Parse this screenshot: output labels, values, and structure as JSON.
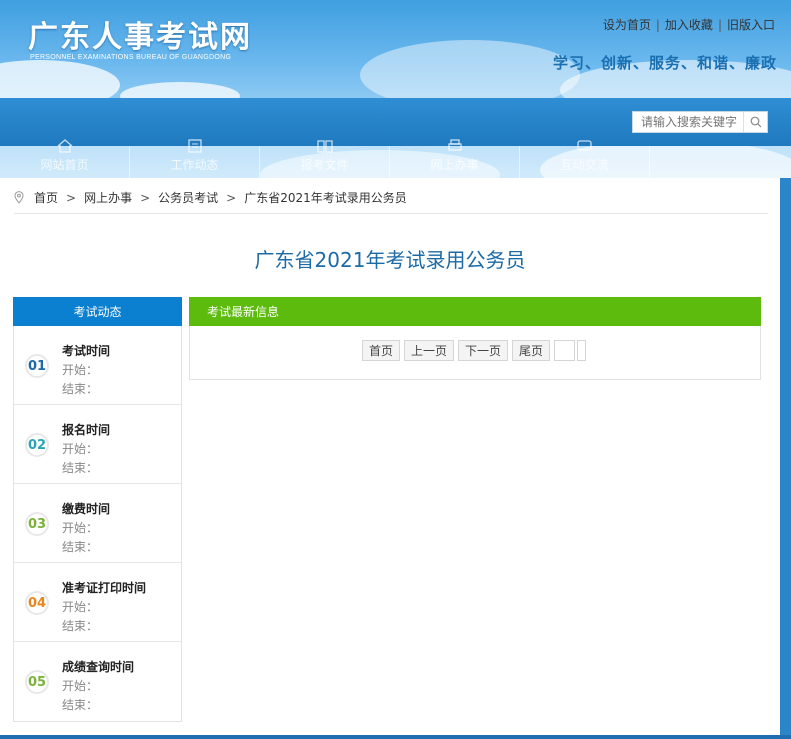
{
  "header": {
    "logo_title": "广东人事考试网",
    "logo_subtitle": "PERSONNEL EXAMINATIONS BUREAU OF GUANGDONG",
    "top_links": [
      "设为首页",
      "加入收藏",
      "旧版入口"
    ],
    "slogan": "学习、创新、服务、和谐、廉政",
    "search_placeholder": "请输入搜索关键字"
  },
  "nav": [
    {
      "label": "网站首页",
      "icon": "home-icon"
    },
    {
      "label": "工作动态",
      "icon": "news-icon"
    },
    {
      "label": "报考文件",
      "icon": "book-icon"
    },
    {
      "label": "网上办事",
      "icon": "print-icon"
    },
    {
      "label": "互动交流",
      "icon": "chat-icon"
    }
  ],
  "breadcrumb": [
    "首页",
    "网上办事",
    "公务员考试",
    "广东省2021年考试录用公务员"
  ],
  "page_title": "广东省2021年考试录用公务员",
  "sidebar": {
    "title": "考试动态",
    "steps": [
      {
        "num": "01",
        "title": "考试时间",
        "start": "开始：",
        "end": "结束：",
        "color": "#1c6aa6"
      },
      {
        "num": "02",
        "title": "报名时间",
        "start": "开始：",
        "end": "结束：",
        "color": "#2aa3b8"
      },
      {
        "num": "03",
        "title": "缴费时间",
        "start": "开始：",
        "end": "结束：",
        "color": "#7ab23a"
      },
      {
        "num": "04",
        "title": "准考证打印时间",
        "start": "开始：",
        "end": "结束：",
        "color": "#e8871e"
      },
      {
        "num": "05",
        "title": "成绩查询时间",
        "start": "开始：",
        "end": "结束：",
        "color": "#7ab23a"
      }
    ]
  },
  "panel": {
    "title": "考试最新信息",
    "pager": [
      "首页",
      "上一页",
      "下一页",
      "尾页"
    ]
  },
  "colors": {
    "sidebar_head": "#0b7fd0",
    "panel_head": "#5cbb0d",
    "title": "#1c6aa6"
  }
}
